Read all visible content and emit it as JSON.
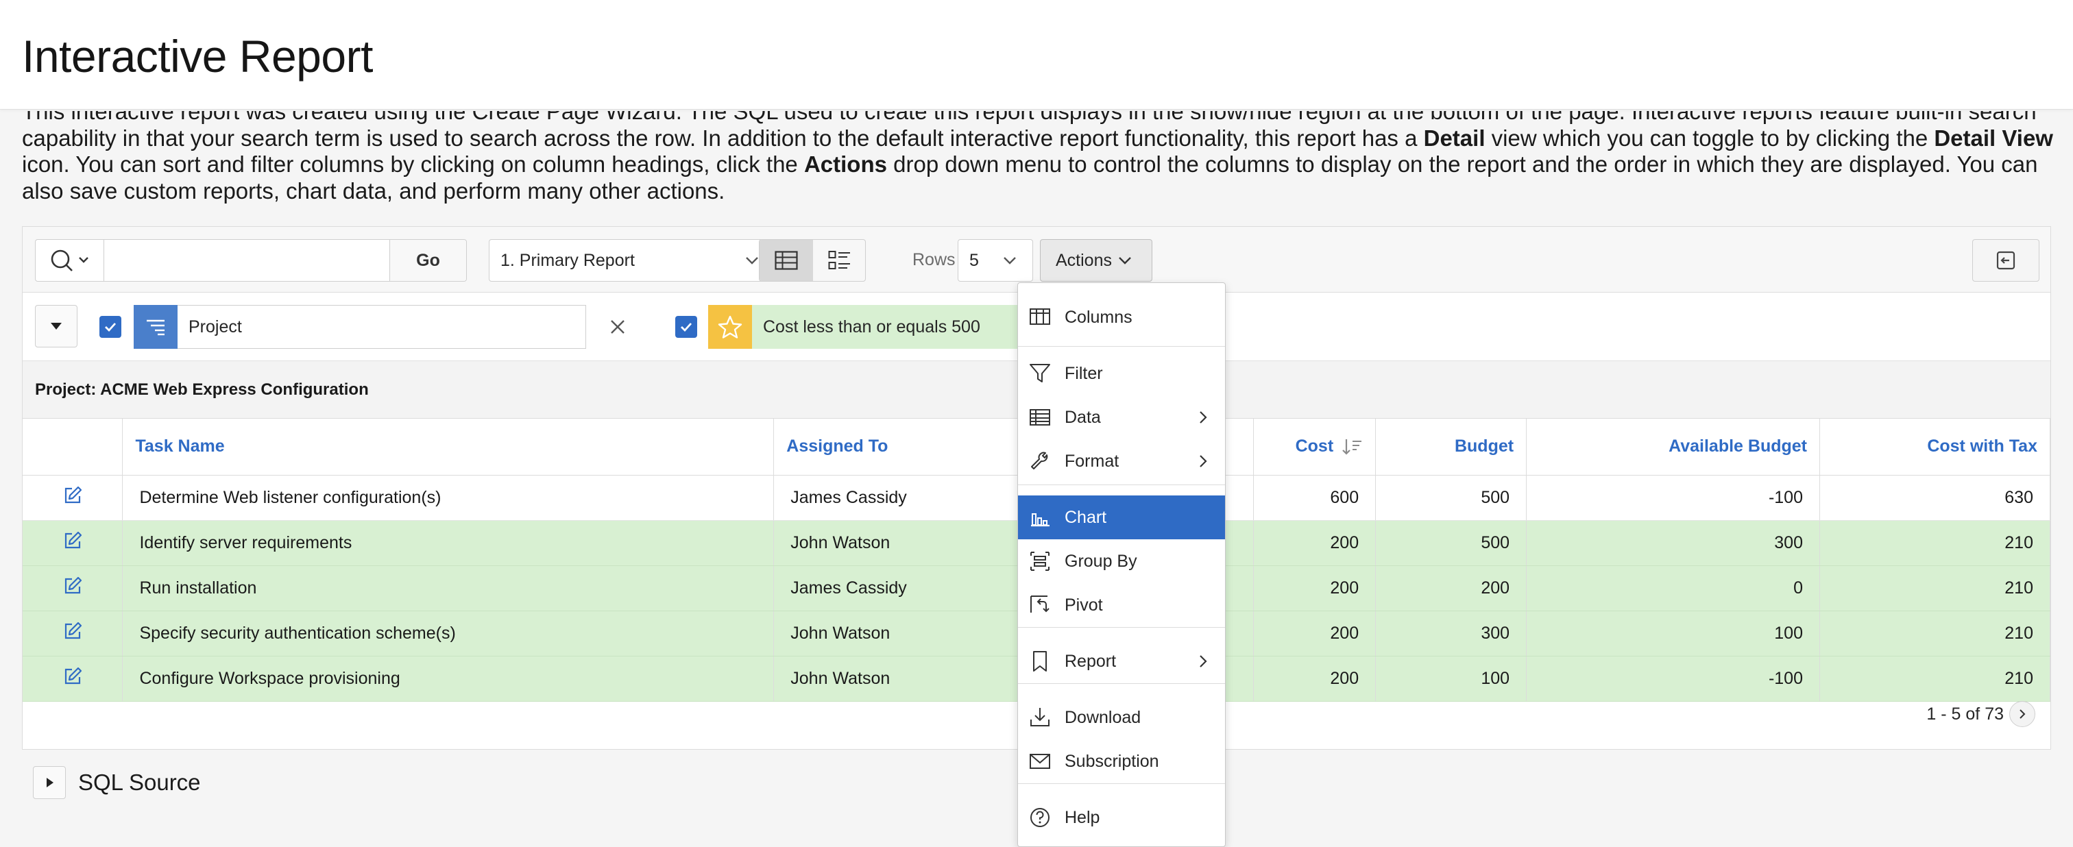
{
  "page": {
    "title": "Interactive Report",
    "intro_parts": [
      "This interactive report was created using the Create Page Wizard. The SQL used to create this report displays in the show/hide region at the bottom of the page. Interactive reports feature built-in search capability in that your search term is used to search across the row. In addition to the default interactive report functionality, this report has a ",
      "Detail",
      " view which you can toggle to by clicking the ",
      "Detail View",
      " icon. You can sort and filter columns by clicking on column headings, click the ",
      "Actions",
      " drop down menu to control the columns to display on the report and the order in which they are displayed. You can also save custom reports, chart data, and perform many other actions."
    ]
  },
  "toolbar": {
    "search_value": "",
    "go_label": "Go",
    "report_select": "1. Primary Report",
    "rows_label": "Rows",
    "rows_value": "5",
    "actions_label": "Actions"
  },
  "filters": {
    "control_break_label": "Project",
    "filter_label": "Cost less than or equals 500"
  },
  "break_header": "Project: ACME Web Express Configuration",
  "table": {
    "columns": [
      "Task Name",
      "Assigned To",
      "Cost",
      "Budget",
      "Available Budget",
      "Cost with Tax"
    ],
    "rows": [
      {
        "task": "Determine Web listener configuration(s)",
        "assigned": "James Cassidy",
        "cost": "600",
        "budget": "500",
        "available": "-100",
        "tax": "630",
        "highlighted": false
      },
      {
        "task": "Identify server requirements",
        "assigned": "John Watson",
        "cost": "200",
        "budget": "500",
        "available": "300",
        "tax": "210",
        "highlighted": true
      },
      {
        "task": "Run installation",
        "assigned": "James Cassidy",
        "cost": "200",
        "budget": "200",
        "available": "0",
        "tax": "210",
        "highlighted": true
      },
      {
        "task": "Specify security authentication scheme(s)",
        "assigned": "John Watson",
        "cost": "200",
        "budget": "300",
        "available": "100",
        "tax": "210",
        "highlighted": true
      },
      {
        "task": "Configure Workspace provisioning",
        "assigned": "John Watson",
        "cost": "200",
        "budget": "100",
        "available": "-100",
        "tax": "210",
        "highlighted": true
      }
    ]
  },
  "pagination": "1 - 5 of 73",
  "sql_region_title": "SQL Source",
  "actions_menu": {
    "items": [
      {
        "label": "Columns",
        "icon": "columns-icon"
      },
      {
        "label": "Filter",
        "icon": "filter-icon"
      },
      {
        "label": "Data",
        "icon": "data-icon",
        "submenu": true
      },
      {
        "label": "Format",
        "icon": "wrench-icon",
        "submenu": true
      },
      {
        "label": "Chart",
        "icon": "chart-icon",
        "active": true
      },
      {
        "label": "Group By",
        "icon": "group-by-icon"
      },
      {
        "label": "Pivot",
        "icon": "pivot-icon"
      },
      {
        "label": "Report",
        "icon": "bookmark-icon",
        "submenu": true
      },
      {
        "label": "Download",
        "icon": "download-icon"
      },
      {
        "label": "Subscription",
        "icon": "envelope-icon"
      },
      {
        "label": "Help",
        "icon": "help-icon"
      }
    ]
  },
  "colors": {
    "accent": "#2f6bc5",
    "highlight_row": "#d8f0d2",
    "filter_chip": "#d8f0d2",
    "star": "#f5c242"
  }
}
